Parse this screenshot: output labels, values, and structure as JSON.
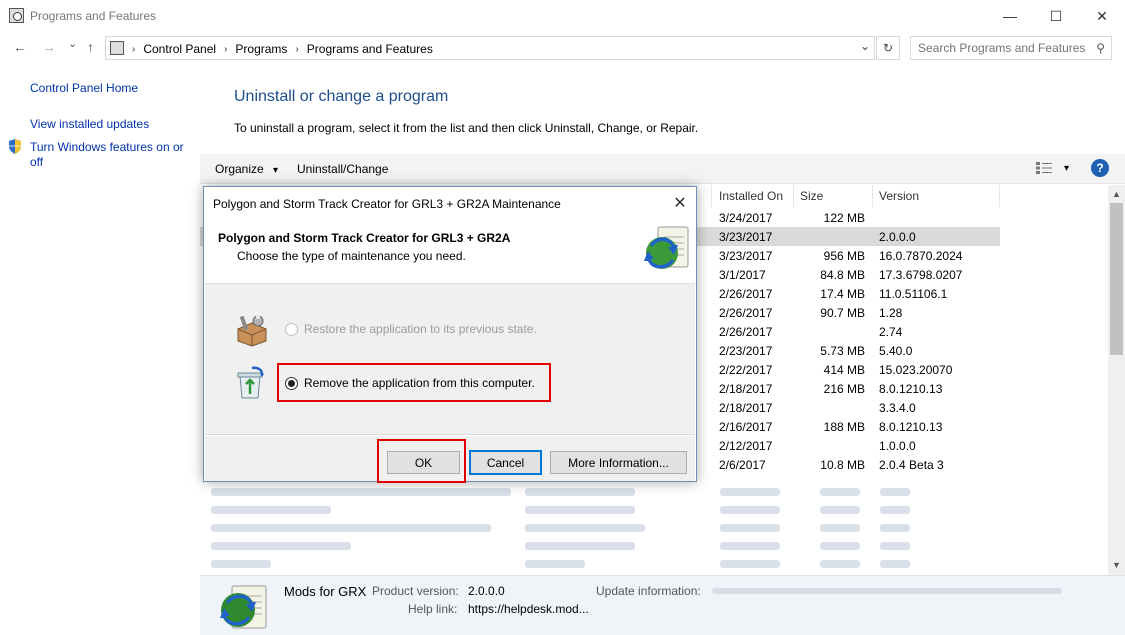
{
  "window": {
    "title": "Programs and Features",
    "minimize": "—",
    "maximize": "☐",
    "close": "✕"
  },
  "address": {
    "back": "←",
    "forward": "→",
    "recent": "⌄",
    "up": "↑",
    "crumbs": [
      "Control Panel",
      "Programs",
      "Programs and Features"
    ],
    "crumb_sep": "›",
    "dropdown": "⌄",
    "refresh": "↻",
    "search_placeholder": "Search Programs and Features",
    "search_icon": "⚲"
  },
  "leftnav": {
    "items": [
      "Control Panel Home",
      "View installed updates",
      "Turn Windows features on or off"
    ]
  },
  "main": {
    "heading": "Uninstall or change a program",
    "instructions": "To uninstall a program, select it from the list and then click Uninstall, Change, or Repair.",
    "toolbar": {
      "organize": "Organize",
      "organize_arrow": "▾",
      "uninstall_change": "Uninstall/Change",
      "view_arrow": "▾",
      "help": "?"
    },
    "columns": [
      "Installed On",
      "Size",
      "Version"
    ],
    "rows": [
      {
        "installed_on": "3/24/2017",
        "size": "122 MB",
        "version": ""
      },
      {
        "installed_on": "3/23/2017",
        "size": "",
        "version": "2.0.0.0",
        "selected": true
      },
      {
        "installed_on": "3/23/2017",
        "size": "956 MB",
        "version": "16.0.7870.2024"
      },
      {
        "installed_on": "3/1/2017",
        "size": "84.8 MB",
        "version": "17.3.6798.0207"
      },
      {
        "installed_on": "2/26/2017",
        "size": "17.4 MB",
        "version": "11.0.51106.1"
      },
      {
        "installed_on": "2/26/2017",
        "size": "90.7 MB",
        "version": "1.28"
      },
      {
        "installed_on": "2/26/2017",
        "size": "",
        "version": "2.74"
      },
      {
        "installed_on": "2/23/2017",
        "size": "5.73 MB",
        "version": "5.40.0"
      },
      {
        "installed_on": "2/22/2017",
        "size": "414 MB",
        "version": "15.023.20070"
      },
      {
        "installed_on": "2/18/2017",
        "size": "216 MB",
        "version": "8.0.1210.13"
      },
      {
        "installed_on": "2/18/2017",
        "size": "",
        "version": "3.3.4.0"
      },
      {
        "installed_on": "2/16/2017",
        "size": "188 MB",
        "version": "8.0.1210.13"
      },
      {
        "installed_on": "2/12/2017",
        "size": "",
        "version": "1.0.0.0"
      },
      {
        "installed_on": "2/6/2017",
        "size": "10.8 MB",
        "version": "2.0.4 Beta 3"
      }
    ]
  },
  "details": {
    "name": "Mods for GRX",
    "product_version_label": "Product version:",
    "product_version": "2.0.0.0",
    "update_info_label": "Update information:",
    "help_link_label": "Help link:",
    "help_link": "https://helpdesk.mod..."
  },
  "dialog": {
    "title": "Polygon and Storm Track Creator for GRL3 + GR2A Maintenance",
    "close": "✕",
    "heading": "Polygon and Storm Track Creator for GRL3 + GR2A",
    "subheading": "Choose the type of maintenance you need.",
    "options": [
      {
        "label": "Restore the application to its previous state.",
        "enabled": false,
        "checked": false
      },
      {
        "label": "Remove the application from this computer.",
        "enabled": true,
        "checked": true
      }
    ],
    "buttons": {
      "ok": "OK",
      "cancel": "Cancel",
      "more_info": "More Information..."
    }
  },
  "colors": {
    "link": "#0033aa",
    "heading": "#1e4e8c",
    "highlight_box": "#e30000",
    "selection": "#d9d9d9",
    "focus": "#0078d7"
  }
}
